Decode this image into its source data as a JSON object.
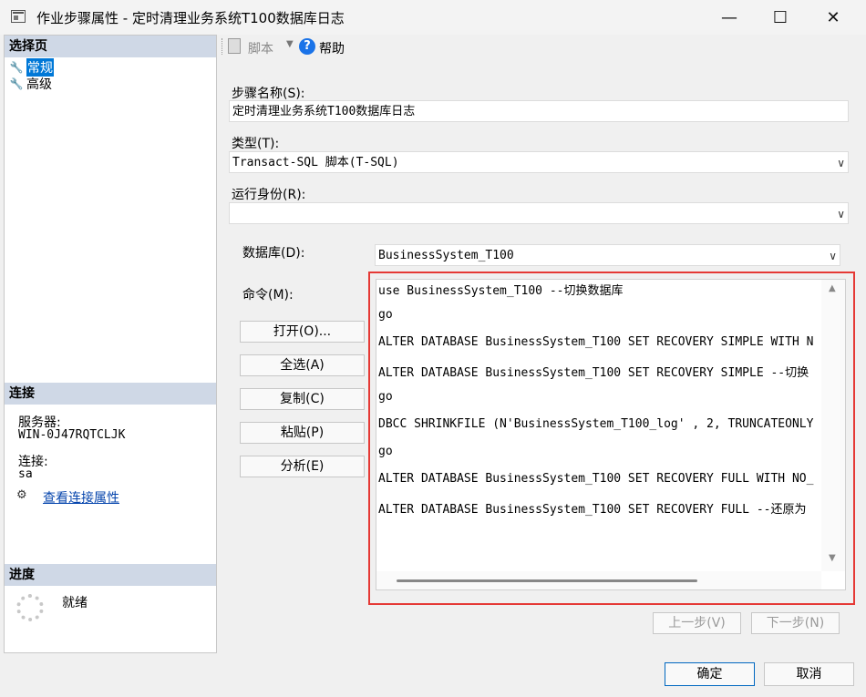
{
  "window": {
    "title": "作业步骤属性 - 定时清理业务系统T100数据库日志",
    "minimize": "—",
    "maximize": "☐",
    "close": "✕"
  },
  "left": {
    "select_page_header": "选择页",
    "pages": [
      {
        "label": "常规",
        "selected": true,
        "icon": "wrench-icon"
      },
      {
        "label": "高级",
        "selected": false,
        "icon": "wrench-icon"
      }
    ],
    "connection_header": "连接",
    "server_label": "服务器:",
    "server_value": "WIN-0J47RQTCLJK",
    "connection_label": "连接:",
    "connection_value": "sa",
    "view_connection_link": "查看连接属性",
    "progress_header": "进度",
    "progress_status": "就绪"
  },
  "toolbar": {
    "script_label": "脚本",
    "help_label": "帮助"
  },
  "form": {
    "step_name_label": "步骤名称(S):",
    "step_name_value": "定时清理业务系统T100数据库日志",
    "type_label": "类型(T):",
    "type_value": "Transact-SQL 脚本(T-SQL)",
    "run_as_label": "运行身份(R):",
    "run_as_value": "",
    "database_label": "数据库(D):",
    "database_value": "BusinessSystem_T100",
    "command_label": "命令(M):",
    "command_lines": [
      "use BusinessSystem_T100  --切换数据库",
      "go",
      "ALTER DATABASE BusinessSystem_T100 SET RECOVERY SIMPLE WITH N",
      "ALTER DATABASE BusinessSystem_T100 SET RECOVERY SIMPLE --切换",
      "go",
      "DBCC SHRINKFILE (N'BusinessSystem_T100_log' , 2, TRUNCATEONLY",
      "go",
      "ALTER DATABASE BusinessSystem_T100 SET RECOVERY FULL WITH NO_",
      "ALTER DATABASE BusinessSystem_T100 SET RECOVERY FULL  --还原为"
    ]
  },
  "buttons": {
    "open": "打开(O)...",
    "select_all": "全选(A)",
    "copy": "复制(C)",
    "paste": "粘贴(P)",
    "parse": "分析(E)",
    "prev_step": "上一步(V)",
    "next_step": "下一步(N)",
    "ok": "确定",
    "cancel": "取消"
  },
  "colors": {
    "highlight_border": "#e53935",
    "selection": "#0078d7",
    "section_header": "#cfd8e6"
  }
}
